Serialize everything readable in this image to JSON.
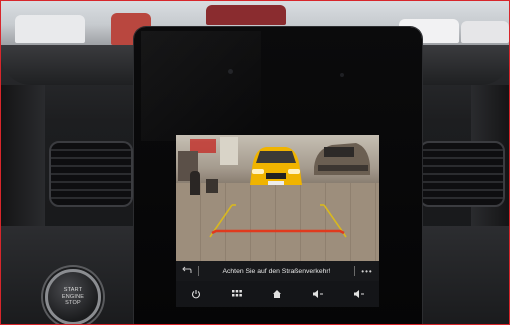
{
  "start_button": {
    "line1": "START",
    "line2": "ENGINE",
    "line3": "STOP"
  },
  "camera_screen": {
    "warning_text": "Achten Sie auf den Straßenverkehr!",
    "back_icon": "back-arrow-icon",
    "more_icon": "more-dots-icon",
    "bottom_icons": [
      "power-icon",
      "grid-menu-icon",
      "home-icon",
      "volume-down-icon",
      "volume-down-icon"
    ],
    "guide_line_color": "#e03a1e",
    "side_guide_color": "#d8b820"
  },
  "car_plate": "",
  "colors": {
    "frame_border": "#d7262b",
    "screen_bg": "#101012",
    "yellow_car": "#f0b400"
  }
}
